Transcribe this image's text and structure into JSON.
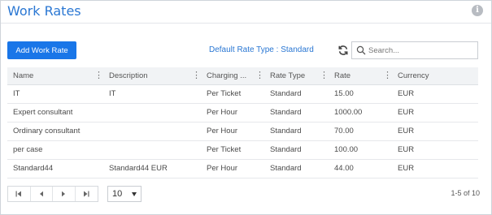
{
  "header": {
    "title": "Work Rates",
    "info_icon": "info-icon"
  },
  "toolbar": {
    "add_label": "Add Work Rate",
    "default_rate_type": "Default Rate Type : Standard",
    "refresh_icon": "refresh-icon",
    "search": {
      "placeholder": "Search...",
      "value": ""
    }
  },
  "table": {
    "columns": [
      "Name",
      "Description",
      "Charging ...",
      "Rate Type",
      "Rate",
      "Currency"
    ],
    "rows": [
      [
        "IT",
        "IT",
        "Per Ticket",
        "Standard",
        "15.00",
        "EUR"
      ],
      [
        "Expert consultant",
        "",
        "Per Hour",
        "Standard",
        "1000.00",
        "EUR"
      ],
      [
        "Ordinary consultant",
        "",
        "Per Hour",
        "Standard",
        "70.00",
        "EUR"
      ],
      [
        "per case",
        "",
        "Per Ticket",
        "Standard",
        "100.00",
        "EUR"
      ],
      [
        "Standard44",
        "Standard44 EUR",
        "Per Hour",
        "Standard",
        "44.00",
        "EUR"
      ]
    ]
  },
  "pagination": {
    "buttons": [
      "first-page-icon",
      "prev-page-icon",
      "next-page-icon",
      "last-page-icon"
    ],
    "page_size": "10",
    "range_text": "1-5 of 10"
  },
  "colors": {
    "accent": "#1976e8",
    "title": "#2a77d3",
    "header_bg": "#f1f3f5"
  }
}
